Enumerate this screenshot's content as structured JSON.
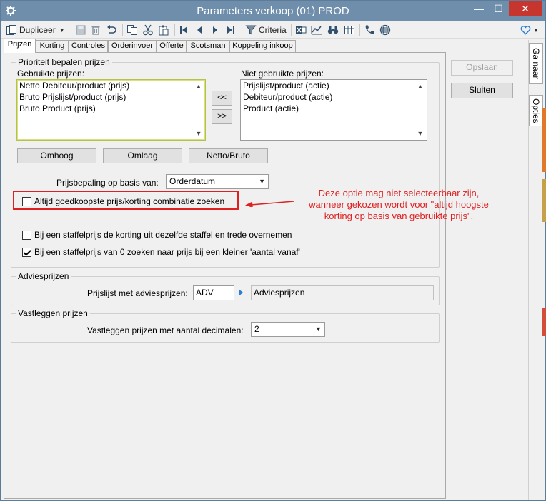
{
  "window": {
    "title": "Parameters verkoop (01)  PROD",
    "min": "—",
    "max": "☐",
    "close": "✕"
  },
  "toolbar": {
    "duplicate_label": "Dupliceer",
    "criteria_label": "Criteria"
  },
  "tabs": [
    "Prijzen",
    "Korting",
    "Controles",
    "Orderinvoer",
    "Offerte",
    "Scotsman",
    "Koppeling inkoop"
  ],
  "side_tabs": [
    "Ga naar",
    "Opties"
  ],
  "priority": {
    "group_title": "Prioriteit bepalen prijzen",
    "used_label": "Gebruikte prijzen:",
    "unused_label": "Niet gebruikte prijzen:",
    "used_items": [
      "Netto Debiteur/product (prijs)",
      "Bruto Prijslijst/product (prijs)",
      "Bruto Product (prijs)"
    ],
    "unused_items": [
      "Prijslijst/product (actie)",
      "Debiteur/product (actie)",
      "Product (actie)"
    ],
    "move_left": "<<",
    "move_right": ">>",
    "up_button": "Omhoog",
    "down_button": "Omlaag",
    "netbruto_button": "Netto/Bruto",
    "basis_label": "Prijsbepaling op basis van:",
    "basis_value": "Orderdatum",
    "cheapest_label": "Altijd goedkoopste prijs/korting combinatie zoeken",
    "cheapest_checked": false,
    "staffel1_label": "Bij een staffelprijs de korting uit dezelfde staffel en trede overnemen",
    "staffel1_checked": false,
    "staffel2_label": "Bij een staffelprijs van 0 zoeken naar prijs bij een kleiner 'aantal vanaf'",
    "staffel2_checked": true
  },
  "advice": {
    "group_title": "Adviesprijzen",
    "label": "Prijslijst met adviesprijzen:",
    "code": "ADV",
    "description": "Adviesprijzen"
  },
  "record": {
    "group_title": "Vastleggen prijzen",
    "label": "Vastleggen prijzen met aantal decimalen:",
    "value": "2"
  },
  "actions": {
    "save": "Opslaan",
    "close": "Sluiten"
  },
  "annotation": {
    "lines": [
      "Deze optie mag niet selecteerbaar zijn,",
      "wanneer gekozen wordt voor \"altijd hoogste",
      "korting op basis van gebruikte prijs\"."
    ],
    "color": "#e02020"
  }
}
